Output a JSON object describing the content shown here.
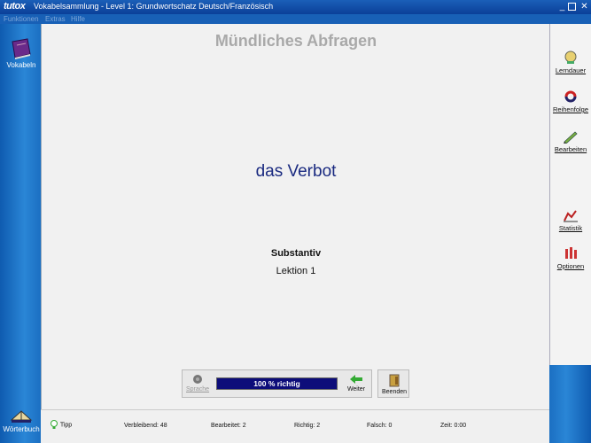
{
  "window": {
    "logo": "tutox",
    "title": "Vokabelsammlung - Level 1: Grundwortschatz Deutsch/Französisch",
    "controls": {
      "minimize": "_",
      "maximize": "",
      "close": "✕"
    }
  },
  "menu": {
    "items": [
      "Funktionen",
      "Extras",
      "Hilfe"
    ]
  },
  "sidebar_left": {
    "vokabeln_label": "Vokabeln",
    "woerterbuch_label": "Wörterbuch"
  },
  "main": {
    "page_title": "Mündliches Abfragen",
    "word": "das Verbot",
    "word_type": "Substantiv",
    "lesson": "Lektion 1"
  },
  "tools_right": [
    {
      "label": "Lerndauer",
      "icon": "clock-icon"
    },
    {
      "label": "Reihenfolge",
      "icon": "order-icon"
    },
    {
      "label": "Bearbeiten",
      "icon": "edit-icon"
    },
    {
      "label": "Statistik",
      "icon": "chart-icon"
    },
    {
      "label": "Optionen",
      "icon": "options-icon"
    }
  ],
  "controls": {
    "sprache_label": "Sprache",
    "progress_text": "100 % richtig",
    "progress_value": 100,
    "weiter_label": "Weiter",
    "beenden_label": "Beenden"
  },
  "status": {
    "tipp_label": "Tipp",
    "verbleibend": "Verbleibend: 48",
    "bearbeitet": "Bearbeitet: 2",
    "richtig": "Richtig: 2",
    "falsch": "Falsch: 0",
    "zeit": "Zeit: 0:00"
  },
  "colors": {
    "titlebar": "#0b3f98",
    "sidebar": "#2a86d6",
    "word": "#1a2a80",
    "progress_fill": "#0d0d7a"
  }
}
